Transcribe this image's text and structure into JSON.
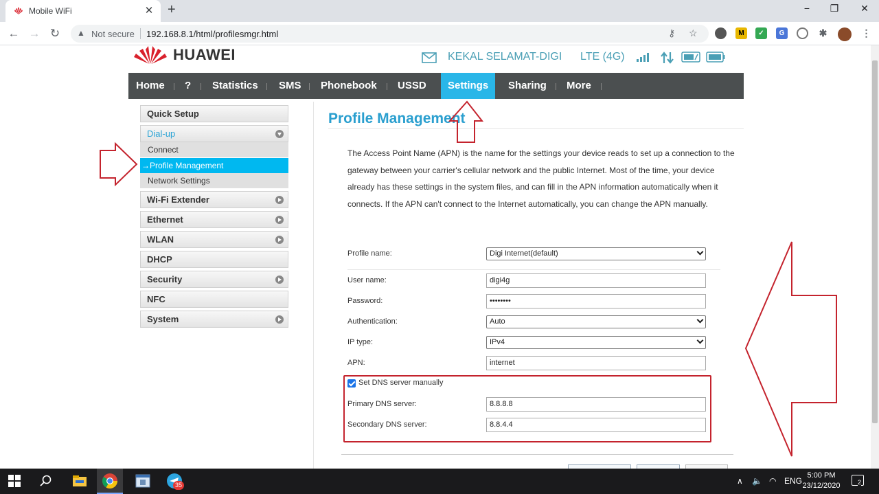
{
  "browser": {
    "tab_title": "Mobile WiFi",
    "new_tab": "+",
    "close_tab": "✕",
    "window_controls": {
      "minimize": "−",
      "restore": "❐",
      "close": "✕"
    },
    "not_secure": "Not secure",
    "url": "192.168.8.1/html/profilesmgr.html"
  },
  "header": {
    "brand": "HUAWEI",
    "operator": "KEKAL SELAMAT-DIGI",
    "network": "LTE (4G)"
  },
  "nav": {
    "items": [
      {
        "label": "Home"
      },
      {
        "label": "?"
      },
      {
        "label": "Statistics"
      },
      {
        "label": "SMS"
      },
      {
        "label": "Phonebook"
      },
      {
        "label": "USSD"
      },
      {
        "label": "Settings"
      },
      {
        "label": "Sharing"
      },
      {
        "label": "More"
      }
    ],
    "active": "Settings"
  },
  "sidebar": {
    "quick_setup": "Quick Setup",
    "dialup": "Dial-up",
    "sub": {
      "connect": "Connect",
      "profile": "Profile Management",
      "network": "Network Settings"
    },
    "wifi_extender": "Wi-Fi Extender",
    "ethernet": "Ethernet",
    "wlan": "WLAN",
    "dhcp": "DHCP",
    "security": "Security",
    "nfc": "NFC",
    "system": "System"
  },
  "main": {
    "title": "Profile Management",
    "description": "The Access Point Name (APN) is the name for the settings your device reads to set up a connection to the gateway between your carrier's cellular network and the public Internet. Most of the time, your device already has these settings in the system files, and can fill in the APN information automatically when it connects. If the APN can't connect to the Internet automatically, you can change the APN manually.",
    "form": {
      "profile_name_label": "Profile name:",
      "profile_name_value": "Digi Internet(default)",
      "username_label": "User name:",
      "username_value": "digi4g",
      "password_label": "Password:",
      "password_value": "••••••••",
      "auth_label": "Authentication:",
      "auth_value": "Auto",
      "iptype_label": "IP type:",
      "iptype_value": "IPv4",
      "apn_label": "APN:",
      "apn_value": "internet",
      "dns_manual_label": "Set DNS server manually",
      "dns_manual_checked": true,
      "primary_dns_label": "Primary DNS server:",
      "primary_dns_value": "8.8.8.8",
      "secondary_dns_label": "Secondary DNS server:",
      "secondary_dns_value": "8.8.4.4"
    }
  },
  "taskbar": {
    "lang": "ENG",
    "time": "5:00 PM",
    "date": "23/12/2020",
    "badge": "35",
    "notifications": "2"
  },
  "colors": {
    "accent": "#29b6e8",
    "title": "#2a9fcf",
    "navbar": "#4b4f50",
    "annotation_red": "#c4232d",
    "brand_red": "#d9212c"
  }
}
